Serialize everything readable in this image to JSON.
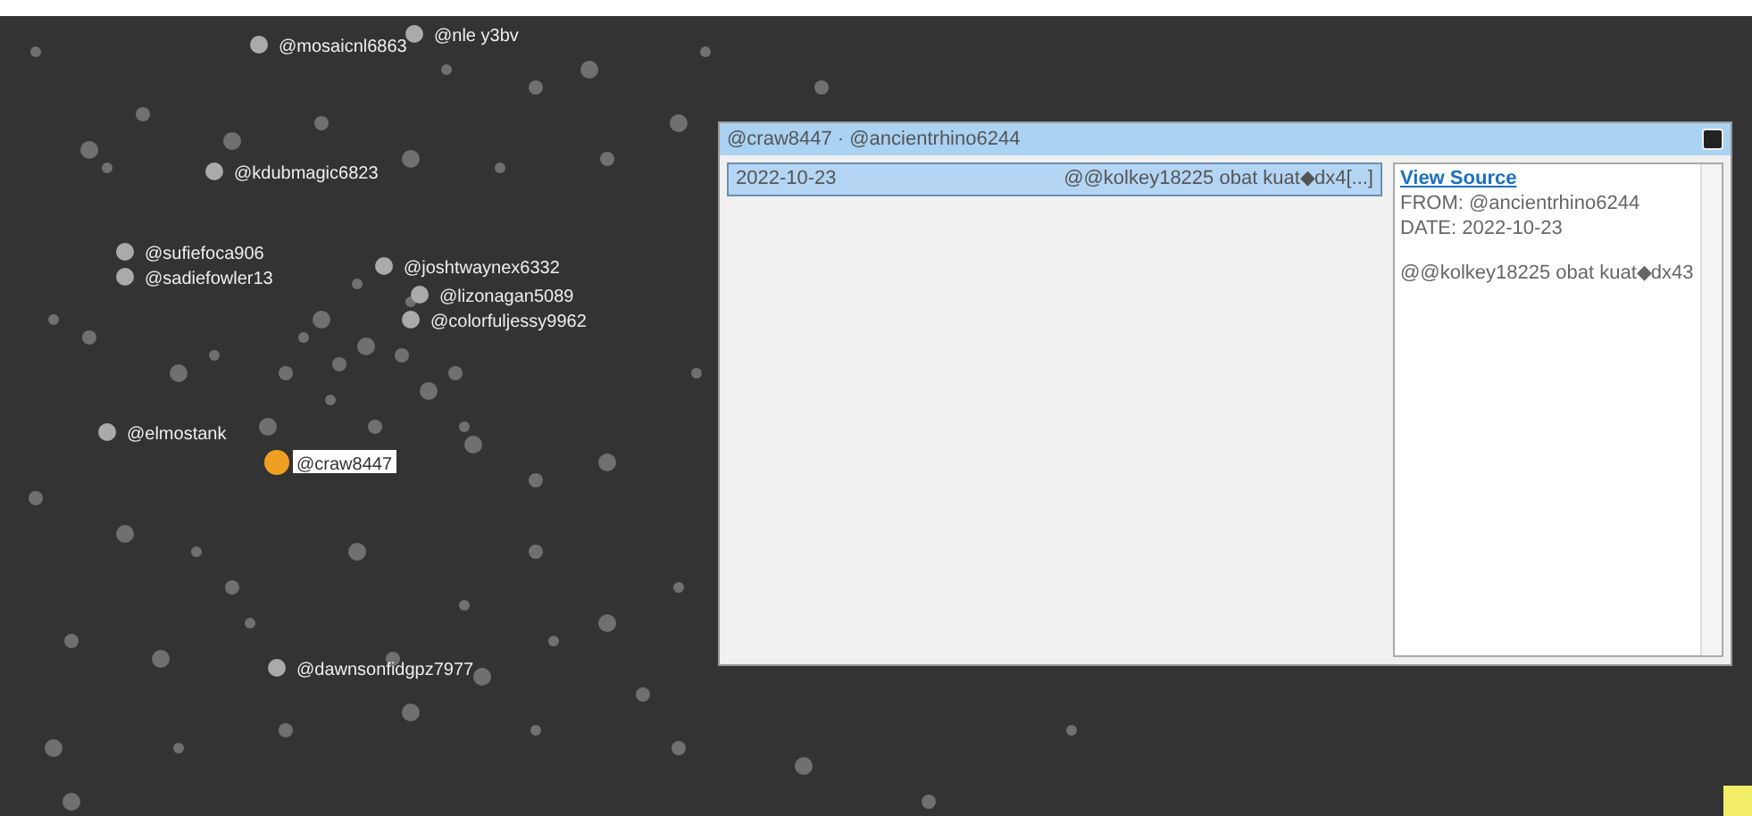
{
  "graph": {
    "nodes": [
      {
        "label": "@mosaicnl6863",
        "selected": false
      },
      {
        "label": "@nle y3bv",
        "selected": false
      },
      {
        "label": "@kdubmagic6823",
        "selected": false
      },
      {
        "label": "@sufiefoca906",
        "selected": false
      },
      {
        "label": "@sadiefowler13",
        "selected": false
      },
      {
        "label": "@joshtwaynex6332",
        "selected": false
      },
      {
        "label": "@lizonagan5089",
        "selected": false
      },
      {
        "label": "@colorfuljessy9962",
        "selected": false
      },
      {
        "label": "@elmostank",
        "selected": false
      },
      {
        "label": "@craw8447",
        "selected": true
      },
      {
        "label": "@dawnsonfidgpz7977",
        "selected": false
      }
    ]
  },
  "popup": {
    "title": "@craw8447 · @ancientrhino6244",
    "messages": [
      {
        "date": "2022-10-23",
        "snippet": "@@kolkey18225 obat kuat◆dx4[...]",
        "selected": true
      }
    ],
    "detail": {
      "link": "View Source",
      "from": "FROM: @ancientrhino6244",
      "date": "DATE: 2022-10-23",
      "body": "@@kolkey18225 obat kuat◆dx43"
    }
  }
}
